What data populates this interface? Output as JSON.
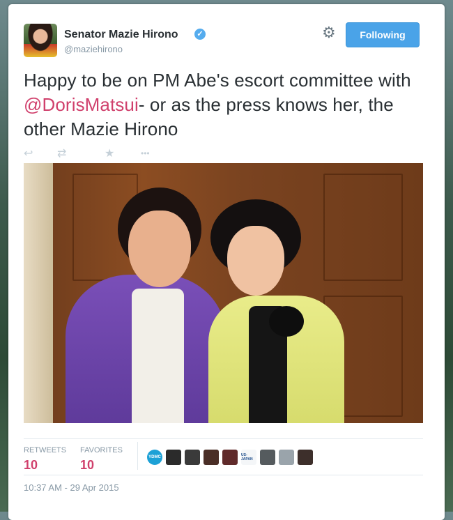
{
  "user": {
    "name": "Senator Mazie Hirono",
    "handle": "@maziehirono",
    "verified_glyph": "✓",
    "follow_label": "Following",
    "settings_icon": "gear-icon"
  },
  "tweet": {
    "text_before": "Happy to be on PM Abe's escort committee with ",
    "mention": "@DorisMatsui",
    "text_after": "- or as the press knows her, the other Mazie Hirono",
    "accent_color": "#d0406c"
  },
  "actions": [
    {
      "name": "reply-icon",
      "glyph": "↩"
    },
    {
      "name": "retweet-icon",
      "glyph": "⇄"
    },
    {
      "name": "favorite-icon",
      "glyph": "★"
    },
    {
      "name": "more-icon",
      "glyph": "•••"
    }
  ],
  "stats": {
    "retweets_label": "RETWEETS",
    "retweets_count": "10",
    "favorites_label": "FAVORITES",
    "favorites_count": "10"
  },
  "favoriters": [
    {
      "name": "ydmc-avatar",
      "text": "YDMC",
      "color": "#1da1d6"
    },
    {
      "name": "user-avatar-2",
      "text": "",
      "color": "#2b2b2b"
    },
    {
      "name": "user-avatar-3",
      "text": "",
      "color": "#3a3a3a"
    },
    {
      "name": "user-avatar-4",
      "text": "",
      "color": "#4a2e26"
    },
    {
      "name": "user-avatar-5",
      "text": "",
      "color": "#602a2a"
    },
    {
      "name": "usjapan-avatar",
      "text": "US-JAPAN",
      "color": "#f4f6f8"
    },
    {
      "name": "user-avatar-7",
      "text": "",
      "color": "#555b5e"
    },
    {
      "name": "user-avatar-8",
      "text": "",
      "color": "#9aa4ab"
    },
    {
      "name": "user-avatar-9",
      "text": "",
      "color": "#3d2f2b"
    }
  ],
  "timestamp": "10:37 AM - 29 Apr 2015"
}
